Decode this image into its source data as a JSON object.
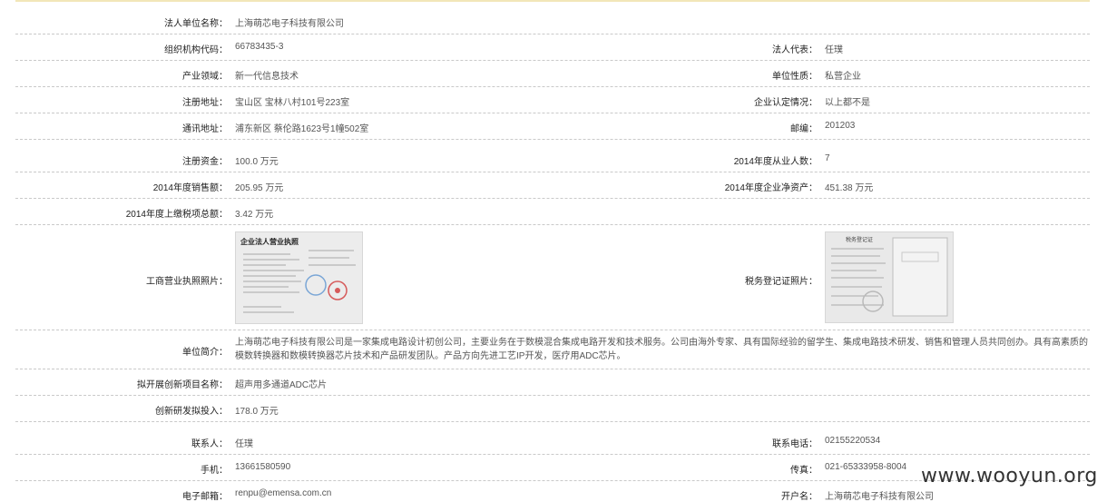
{
  "rows": [
    {
      "label": "法人单位名称：",
      "value": "上海萌芯电子科技有限公司"
    },
    {
      "label": "组织机构代码：",
      "value": "66783435-3",
      "label2": "法人代表：",
      "value2": "任璞"
    },
    {
      "label": "产业领域：",
      "value": "新一代信息技术",
      "label2": "单位性质：",
      "value2": "私营企业"
    },
    {
      "label": "注册地址：",
      "value": "宝山区 宝林八村101号223室",
      "label2": "企业认定情况：",
      "value2": "以上都不是"
    },
    {
      "label": "通讯地址：",
      "value": "浦东新区 蔡伦路1623号1幢502室",
      "label2": "邮编：",
      "value2": "201203"
    },
    {
      "label": "注册资金：",
      "value": "100.0 万元",
      "label2": "2014年度从业人数：",
      "value2": "7"
    },
    {
      "label": "2014年度销售额：",
      "value": "205.95 万元",
      "label2": "2014年度企业净资产：",
      "value2": "451.38 万元"
    },
    {
      "label": "2014年度上缴税项总额：",
      "value": "3.42 万元"
    },
    {
      "label": "工商营业执照照片：",
      "label2": "税务登记证照片："
    },
    {
      "label": "单位简介：",
      "value": "上海萌芯电子科技有限公司是一家集成电路设计初创公司，主要业务在于数模混合集成电路开发和技术服务。公司由海外专家、具有国际经验的留学生、集成电路技术研发、销售和管理人员共同创办。具有高素质的模数转换器和数模转换器芯片技术和产品研发团队。产品方向先进工艺IP开发，医疗用ADC芯片。"
    },
    {
      "label": "拟开展创新项目名称：",
      "value": "超声用多通道ADC芯片"
    },
    {
      "label": "创新研发拟投入：",
      "value": "178.0 万元"
    },
    {
      "label": "联系人：",
      "value": "任璞",
      "label2": "联系电话：",
      "value2": "02155220534"
    },
    {
      "label": "手机：",
      "value": "13661580590",
      "label2": "传真：",
      "value2": "021-65333958-8004"
    },
    {
      "label": "电子邮箱：",
      "value": "renpu@emensa.com.cn",
      "label2": "开户名：",
      "value2": "上海萌芯电子科技有限公司"
    }
  ],
  "license_photo": {
    "title": "企业法人营业执照"
  },
  "tax_photo": {
    "title": "税务登记证"
  },
  "watermark": "www.wooyun.org"
}
